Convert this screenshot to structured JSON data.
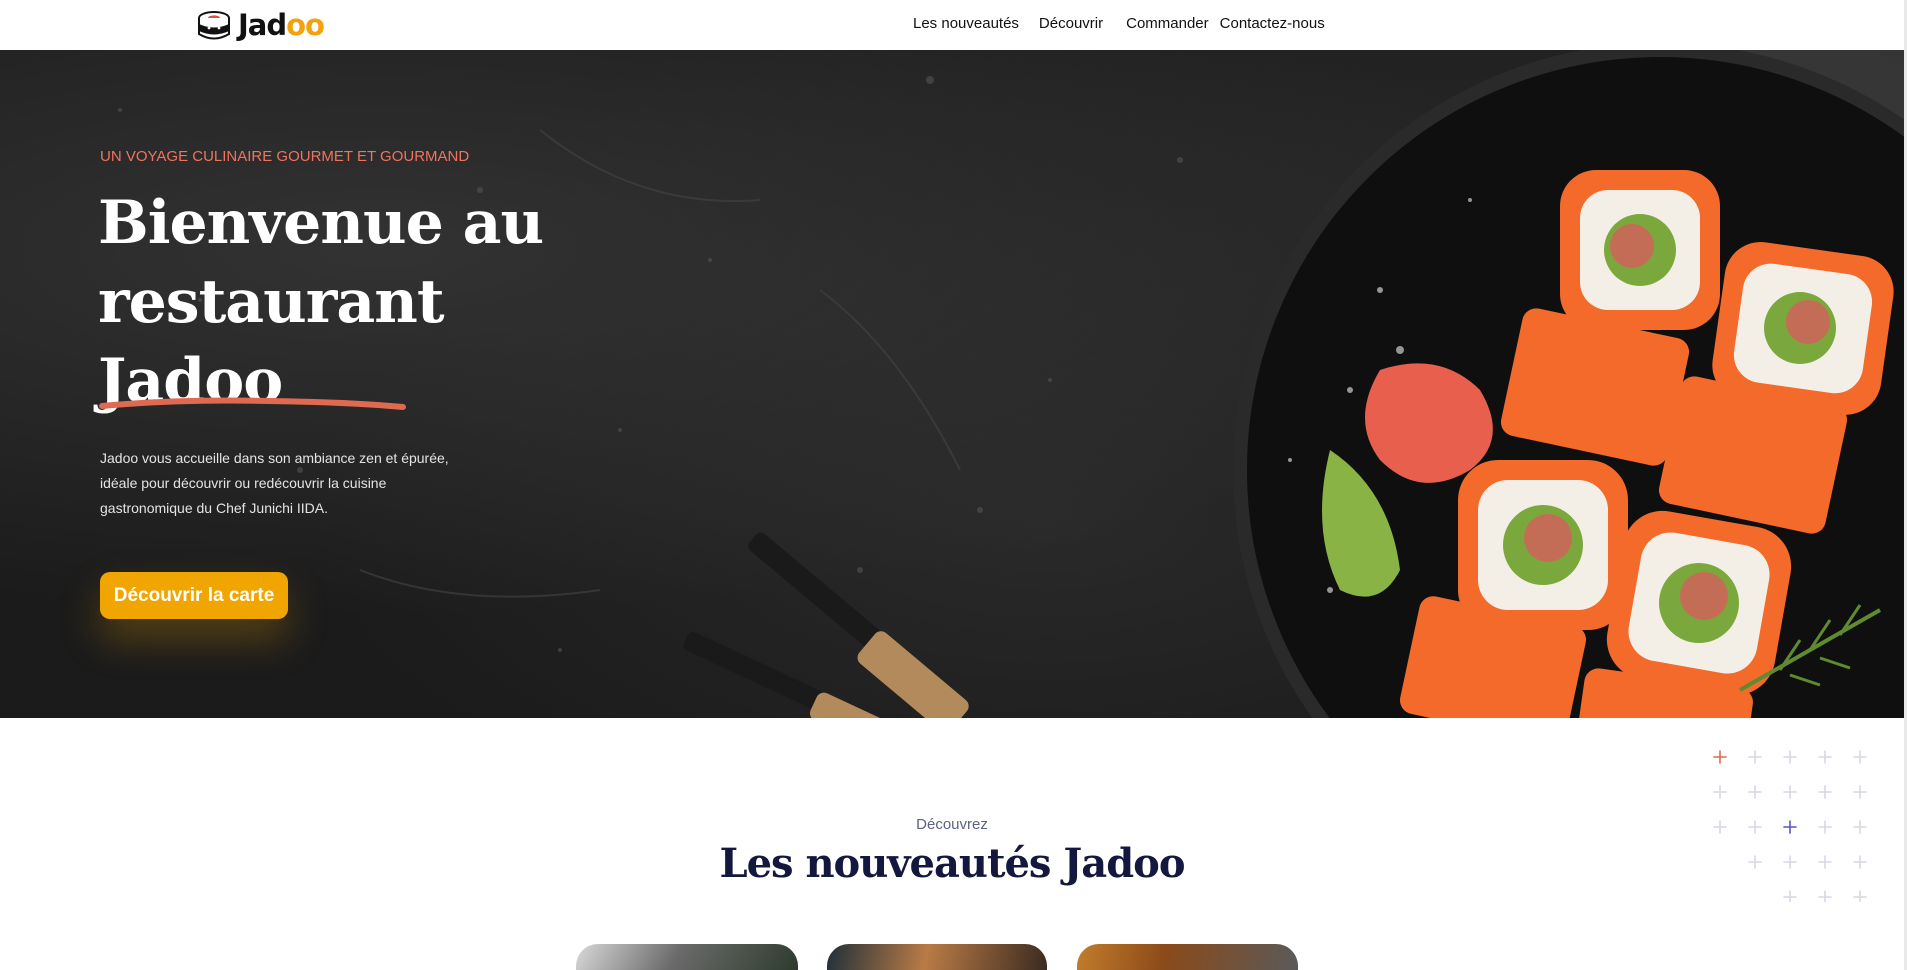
{
  "brand": {
    "name_prefix": "Jad",
    "name_suffix": "oo",
    "logo_icon": "sushi-mascot-icon"
  },
  "nav": {
    "items": [
      {
        "label": "Les nouveautés"
      },
      {
        "label": "Découvrir"
      },
      {
        "label": "Commander"
      },
      {
        "label": "Contactez-nous"
      }
    ]
  },
  "hero": {
    "tagline": "UN VOYAGE CULINAIRE GOURMET ET GOURMAND",
    "title_line1": "Bienvenue au",
    "title_line2": "restaurant",
    "title_line3": "Jadoo",
    "description": "Jadoo vous accueille dans son ambiance zen et épurée, idéale pour découvrir ou redécouvrir la cuisine gastronomique du Chef Junichi IIDA.",
    "button_label": "Découvrir la carte",
    "image": "sushi-plate-image"
  },
  "section": {
    "subtitle": "Découvrez",
    "title": "Les nouveautés Jadoo",
    "cards": [
      {
        "image": "dish-card-image-1"
      },
      {
        "image": "dish-card-image-2"
      },
      {
        "image": "dish-card-image-3"
      }
    ]
  },
  "colors": {
    "accent": "#f1a501",
    "tagline": "#f1735e",
    "underline": "#df6951",
    "cross_red": "#df6951",
    "cross_purple": "#5c54c4",
    "cross_grey": "#d5d9e2"
  }
}
